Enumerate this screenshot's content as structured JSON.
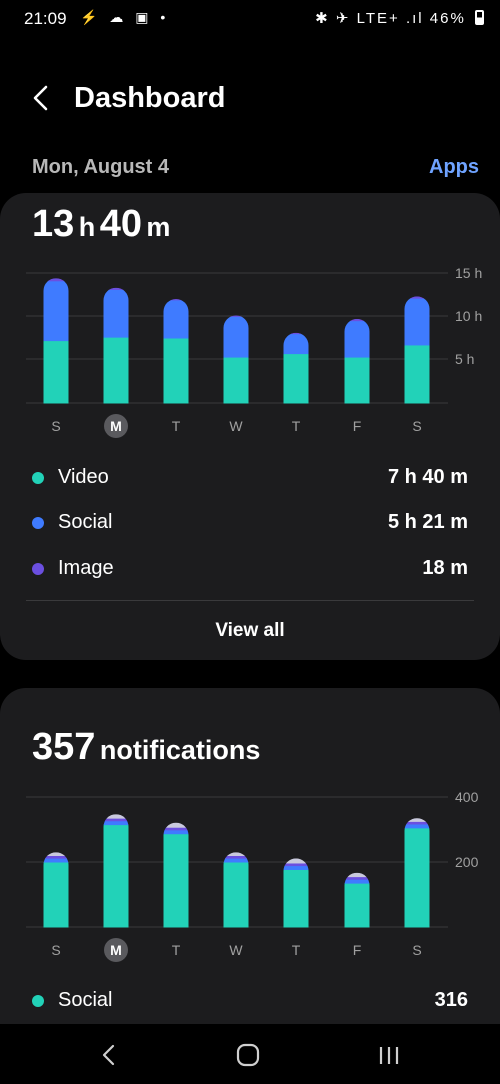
{
  "status": {
    "time": "21:09",
    "left_icons": "⚡ ☁ ▣ •",
    "right_icons": "✱ ✈ LTE+ .ıl",
    "battery": "46%"
  },
  "header": {
    "title": "Dashboard",
    "back_icon": "chevron-left-icon"
  },
  "date": "Mon, August 4",
  "apps_label": "Apps",
  "screen_time": {
    "hours": "13",
    "h_unit": "h",
    "minutes": "40",
    "m_unit": "m",
    "legend": [
      {
        "label": "Video",
        "value": "7 h 40 m",
        "color": "#22d2b8"
      },
      {
        "label": "Social",
        "value": "5 h 21 m",
        "color": "#3f7bff"
      },
      {
        "label": "Image",
        "value": "18 m",
        "color": "#6b4fe0"
      }
    ],
    "view_all": "View all"
  },
  "notifications": {
    "count": "357",
    "label": "notifications",
    "legend": [
      {
        "label": "Social",
        "value": "316",
        "color": "#22d2b8"
      }
    ]
  },
  "chart_data": [
    {
      "type": "bar",
      "stacked": true,
      "categories": [
        "S",
        "M",
        "T",
        "W",
        "T",
        "F",
        "S"
      ],
      "selected_index": 1,
      "yticks": [
        "15 h",
        "10 h",
        "5 h"
      ],
      "ylim": [
        0,
        15
      ],
      "series": [
        {
          "name": "Video",
          "color": "#22d2b8",
          "values": [
            7.2,
            7.6,
            7.5,
            5.3,
            5.7,
            5.3,
            6.7
          ]
        },
        {
          "name": "Social",
          "color": "#3f7bff",
          "values": [
            6.9,
            5.5,
            4.4,
            4.7,
            2.3,
            4.2,
            5.4
          ]
        },
        {
          "name": "Image",
          "color": "#6b4fe0",
          "values": [
            0.3,
            0.2,
            0.1,
            0.1,
            0.1,
            0.2,
            0.2
          ]
        }
      ]
    },
    {
      "type": "bar",
      "stacked": true,
      "categories": [
        "S",
        "M",
        "T",
        "W",
        "T",
        "F",
        "S"
      ],
      "selected_index": 1,
      "yticks": [
        "400",
        "200"
      ],
      "ylim": [
        0,
        400
      ],
      "series": [
        {
          "name": "Social",
          "color": "#22d2b8",
          "values": [
            200,
            315,
            287,
            200,
            177,
            135,
            305
          ]
        },
        {
          "name": "",
          "color": "#3f7bff",
          "values": [
            12,
            12,
            12,
            12,
            12,
            12,
            12
          ]
        },
        {
          "name": "",
          "color": "#6b4fe0",
          "values": [
            8,
            8,
            8,
            8,
            8,
            8,
            8
          ]
        },
        {
          "name": "",
          "color": "#c9c9dd",
          "values": [
            10,
            12,
            14,
            10,
            14,
            12,
            10
          ]
        }
      ]
    }
  ]
}
